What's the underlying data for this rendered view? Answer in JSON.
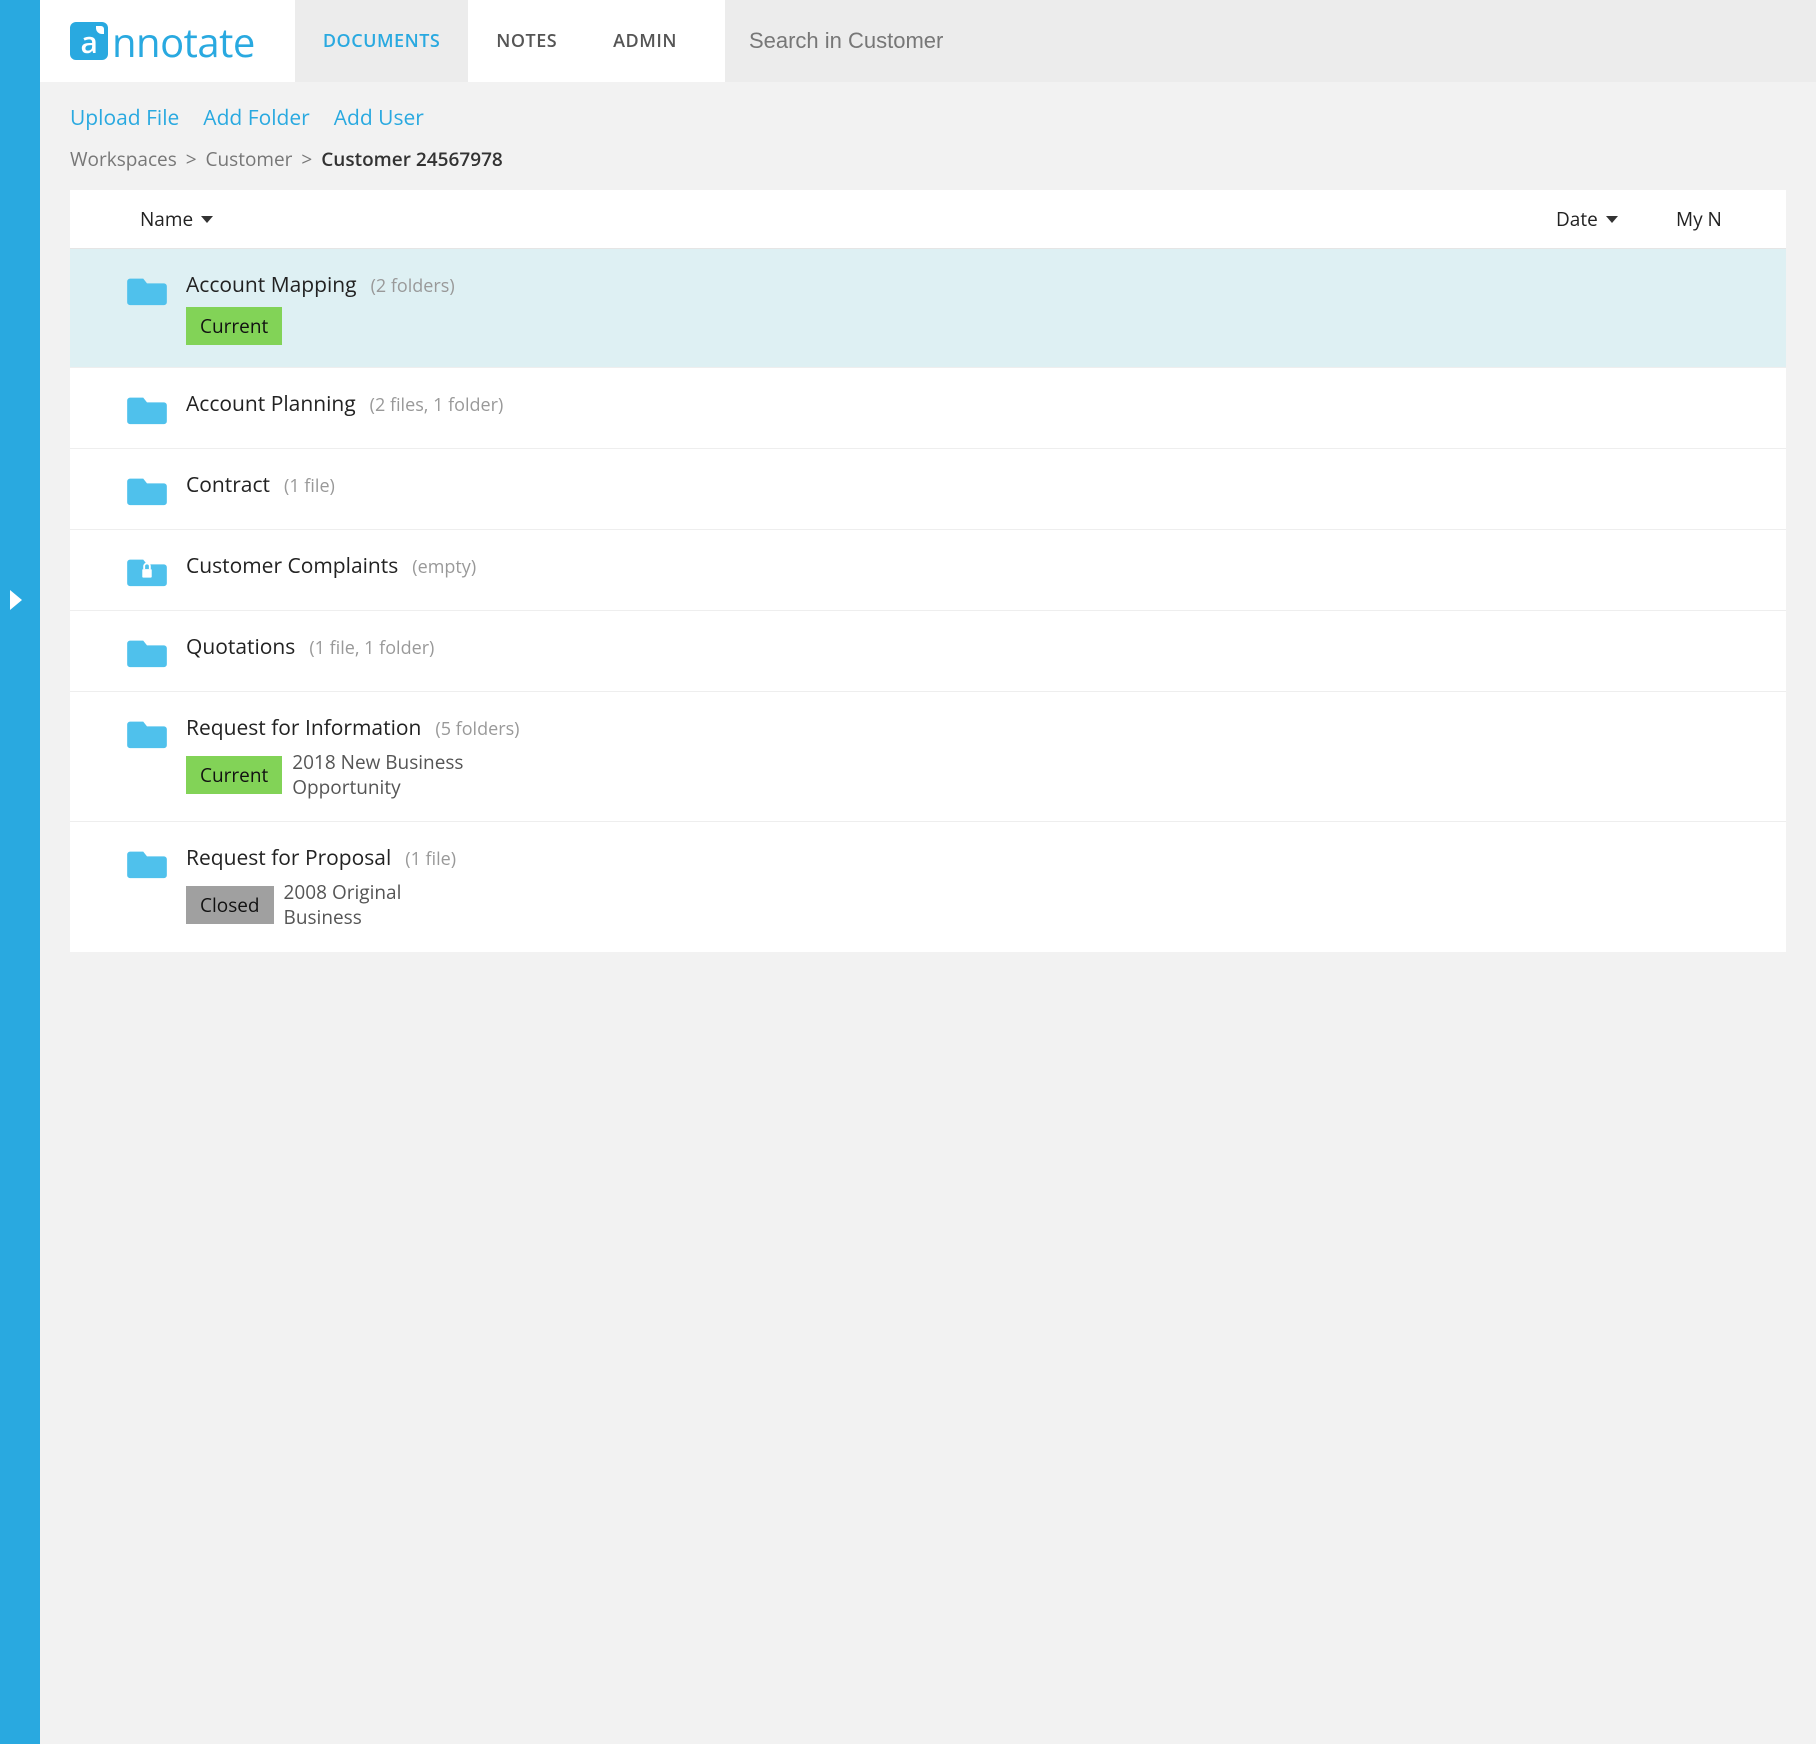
{
  "brand": {
    "name": "nnotate",
    "mark": "a"
  },
  "nav": {
    "tabs": [
      {
        "label": "DOCUMENTS",
        "active": true
      },
      {
        "label": "NOTES",
        "active": false
      },
      {
        "label": "ADMIN",
        "active": false
      }
    ]
  },
  "search": {
    "placeholder": "Search in Customer"
  },
  "actions": {
    "upload": "Upload File",
    "add_folder": "Add Folder",
    "add_user": "Add User"
  },
  "breadcrumb": {
    "sep": ">",
    "items": [
      {
        "label": "Workspaces",
        "current": false
      },
      {
        "label": "Customer",
        "current": false
      },
      {
        "label": "Customer 24567978",
        "current": true
      }
    ]
  },
  "columns": {
    "name": "Name",
    "date": "Date",
    "notes": "My N"
  },
  "rows": [
    {
      "title": "Account Mapping",
      "meta": "(2 folders)",
      "locked": false,
      "selected": true,
      "tag": {
        "label": "Current",
        "style": "green"
      },
      "tag_desc": ""
    },
    {
      "title": "Account Planning",
      "meta": "(2 files, 1 folder)",
      "locked": false,
      "selected": false
    },
    {
      "title": "Contract",
      "meta": "(1 file)",
      "locked": false,
      "selected": false
    },
    {
      "title": "Customer Complaints",
      "meta": "(empty)",
      "locked": true,
      "selected": false
    },
    {
      "title": "Quotations",
      "meta": "(1 file, 1 folder)",
      "locked": false,
      "selected": false
    },
    {
      "title": "Request for Information",
      "meta": "(5 folders)",
      "locked": false,
      "selected": false,
      "tag": {
        "label": "Current",
        "style": "green"
      },
      "tag_desc": "2018 New Business Opportunity"
    },
    {
      "title": "Request for Proposal",
      "meta": "(1 file)",
      "locked": false,
      "selected": false,
      "tag": {
        "label": "Closed",
        "style": "gray"
      },
      "tag_desc": "2008 Original Business"
    }
  ]
}
